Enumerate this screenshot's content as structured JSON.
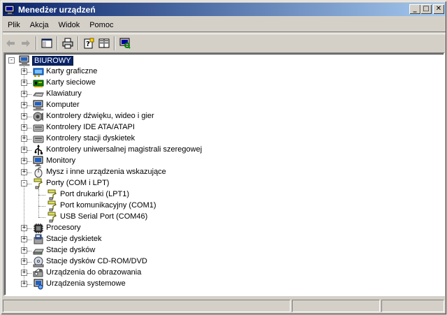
{
  "window": {
    "title": "Menedżer urządzeń"
  },
  "title_buttons": {
    "minimize": "_",
    "maximize": "□",
    "close": "✕"
  },
  "menu": [
    {
      "label": "Plik"
    },
    {
      "label": "Akcja"
    },
    {
      "label": "Widok"
    },
    {
      "label": "Pomoc"
    }
  ],
  "toolbar": {
    "icons": [
      "back-arrow-icon",
      "forward-arrow-icon",
      "show-hide-tree-icon",
      "print-icon",
      "properties-icon",
      "help-icon",
      "scan-hardware-icon"
    ]
  },
  "tree": {
    "root": {
      "label": "BIUROWY",
      "expander": "-"
    },
    "categories": [
      {
        "label": "Karty graficzne",
        "icon": "display-adapter-icon",
        "expander": "+"
      },
      {
        "label": "Karty sieciowe",
        "icon": "network-adapter-icon",
        "expander": "+"
      },
      {
        "label": "Klawiatury",
        "icon": "keyboard-icon",
        "expander": "+"
      },
      {
        "label": "Komputer",
        "icon": "computer-icon",
        "expander": "+"
      },
      {
        "label": "Kontrolery dźwięku, wideo i gier",
        "icon": "sound-icon",
        "expander": "+"
      },
      {
        "label": "Kontrolery IDE ATA/ATAPI",
        "icon": "ide-controller-icon",
        "expander": "+"
      },
      {
        "label": "Kontrolery stacji dyskietek",
        "icon": "floppy-controller-icon",
        "expander": "+"
      },
      {
        "label": "Kontrolery uniwersalnej magistrali szeregowej",
        "icon": "usb-icon",
        "expander": "+"
      },
      {
        "label": "Monitory",
        "icon": "monitor-icon",
        "expander": "+"
      },
      {
        "label": "Mysz i inne urządzenia wskazujące",
        "icon": "mouse-icon",
        "expander": "+"
      },
      {
        "label": "Porty (COM i LPT)",
        "icon": "port-icon",
        "expander": "-",
        "children": [
          {
            "label": "Port drukarki (LPT1)",
            "icon": "port-icon"
          },
          {
            "label": "Port komunikacyjny (COM1)",
            "icon": "port-icon"
          },
          {
            "label": "USB Serial Port (COM46)",
            "icon": "port-icon"
          }
        ]
      },
      {
        "label": "Procesory",
        "icon": "processor-icon",
        "expander": "+"
      },
      {
        "label": "Stacje dyskietek",
        "icon": "floppy-drive-icon",
        "expander": "+"
      },
      {
        "label": "Stacje dysków",
        "icon": "disk-drive-icon",
        "expander": "+"
      },
      {
        "label": "Stacje dysków CD-ROM/DVD",
        "icon": "cdrom-icon",
        "expander": "+"
      },
      {
        "label": "Urządzenia do obrazowania",
        "icon": "imaging-device-icon",
        "expander": "+"
      },
      {
        "label": "Urządzenia systemowe",
        "icon": "system-devices-icon",
        "expander": "+"
      }
    ]
  },
  "colors": {
    "titlebar_start": "#0a246a",
    "titlebar_end": "#a6caf0",
    "face": "#d4d0c8",
    "selection": "#0a246a"
  }
}
